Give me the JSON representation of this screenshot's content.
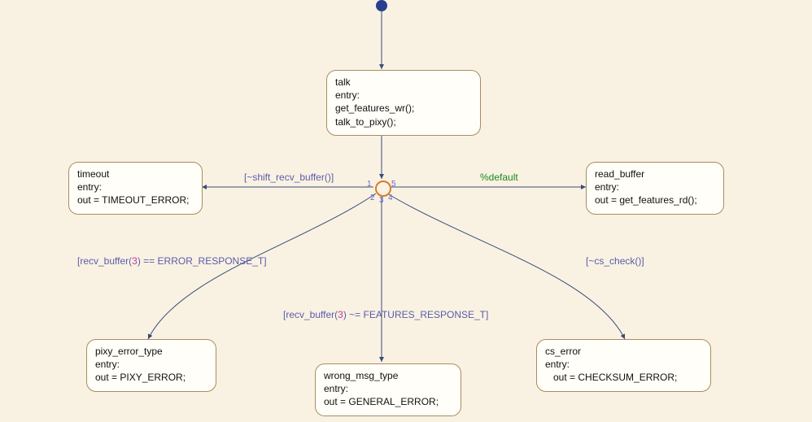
{
  "initial_state": "talk",
  "states": {
    "talk": {
      "name": "talk",
      "entry_kw": "entry:",
      "actions": [
        "get_features_wr();",
        "talk_to_pixy();"
      ]
    },
    "timeout": {
      "name": "timeout",
      "entry_kw": "entry:",
      "action": "out = TIMEOUT_ERROR;"
    },
    "read_buffer": {
      "name": "read_buffer",
      "entry_kw": "entry:",
      "action": "out = get_features_rd();"
    },
    "pixy_error_type": {
      "name": "pixy_error_type",
      "entry_kw": "entry:",
      "action": "out = PIXY_ERROR;"
    },
    "wrong_msg_type": {
      "name": "wrong_msg_type",
      "entry_kw": "entry:",
      "action": "out = GENERAL_ERROR;"
    },
    "cs_error": {
      "name": "cs_error",
      "entry_kw": "entry:",
      "action": "   out = CHECKSUM_ERROR;"
    }
  },
  "junction": {
    "ports": {
      "p1": "1",
      "p2": "2",
      "p3": "3",
      "p4": "4",
      "p5": "5"
    }
  },
  "transitions": {
    "t_shift": {
      "label_pre": "[~shift_recv_buffer()]"
    },
    "t_default": {
      "label": "%default"
    },
    "t_err_resp": {
      "label_pre": "[recv_buffer(",
      "label_idx": "3",
      "label_post": ") == ERROR_RESPONSE_T]"
    },
    "t_feat_resp": {
      "label_pre": "[recv_buffer(",
      "label_idx": "3",
      "label_post": ") ~= FEATURES_RESPONSE_T]"
    },
    "t_cs": {
      "label": "[~cs_check()]"
    }
  }
}
